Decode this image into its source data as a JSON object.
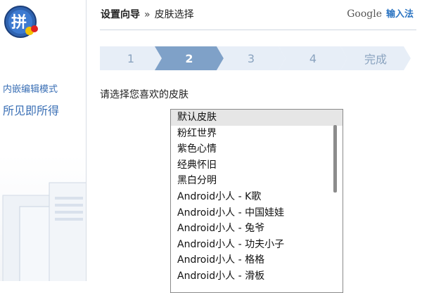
{
  "sidebar": {
    "logo_char": "拼",
    "mode_label": "内嵌编辑模式",
    "wysiwyg_label": "所见即所得"
  },
  "header": {
    "step_title": "设置向导",
    "separator": "»",
    "current_page": "皮肤选择",
    "brand_google": "Google",
    "brand_ime": "输入法"
  },
  "steps": [
    "1",
    "2",
    "3",
    "4",
    "完成"
  ],
  "active_step": 2,
  "content": {
    "prompt": "请选择您喜欢的皮肤",
    "skins": [
      "默认皮肤",
      "粉红世界",
      "紫色心情",
      "经典怀旧",
      "黑白分明",
      "Android小人 - K歌",
      "Android小人 - 中国娃娃",
      "Android小人 - 兔爷",
      "Android小人 - 功夫小子",
      "Android小人 - 格格",
      "Android小人 - 滑板"
    ],
    "selected_index": 0
  },
  "colors": {
    "accent": "#2b74c2",
    "step_active": "#7fa1c8",
    "step_inactive": "#e7eef7",
    "link": "#3a6fb5"
  }
}
